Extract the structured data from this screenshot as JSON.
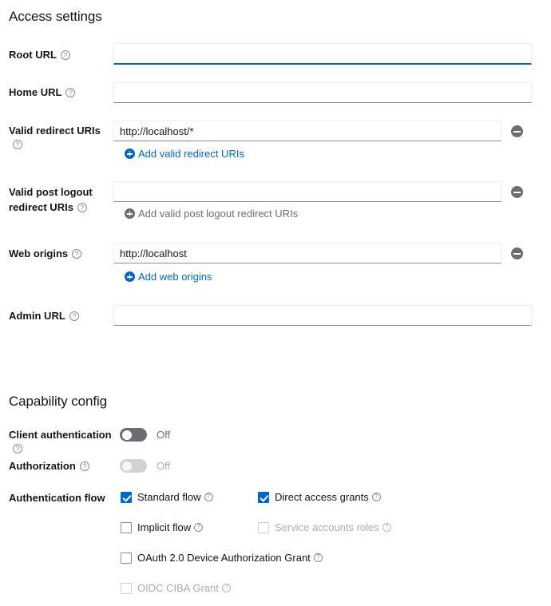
{
  "access_settings": {
    "title": "Access settings",
    "fields": [
      {
        "label": "Root URL",
        "value": "",
        "has_help": true,
        "focused": true,
        "has_remove": false,
        "add_link": null
      },
      {
        "label": "Home URL",
        "value": "",
        "has_help": true,
        "focused": false,
        "has_remove": false,
        "add_link": null
      },
      {
        "label": "Valid redirect URIs",
        "value": "http://localhost/*",
        "has_help": true,
        "focused": false,
        "has_remove": true,
        "add_link": "Add valid redirect URIs",
        "add_link_disabled": false
      },
      {
        "label_line1": "Valid post logout",
        "label_line2": "redirect URIs",
        "label": "Valid post logout redirect URIs",
        "value": "",
        "has_help": true,
        "focused": false,
        "has_remove": true,
        "add_link": "Add valid post logout redirect URIs",
        "add_link_disabled": true
      },
      {
        "label": "Web origins",
        "value": "http://localhost",
        "has_help": true,
        "focused": false,
        "has_remove": true,
        "add_link": "Add web origins",
        "add_link_disabled": false
      },
      {
        "label": "Admin URL",
        "value": "",
        "has_help": true,
        "focused": false,
        "has_remove": false,
        "add_link": null
      }
    ]
  },
  "capability_config": {
    "title": "Capability config",
    "client_authentication": {
      "label": "Client authentication",
      "state_text": "Off",
      "on": false,
      "disabled": false
    },
    "authorization": {
      "label": "Authorization",
      "state_text": "Off",
      "on": false,
      "disabled": true
    },
    "authentication_flow": {
      "label": "Authentication flow",
      "options": [
        {
          "label": "Standard flow",
          "checked": true,
          "disabled": false
        },
        {
          "label": "Direct access grants",
          "checked": true,
          "disabled": false
        },
        {
          "label": "Implicit flow",
          "checked": false,
          "disabled": false
        },
        {
          "label": "Service accounts roles",
          "checked": false,
          "disabled": true
        },
        {
          "label": "OAuth 2.0 Device Authorization Grant",
          "checked": false,
          "disabled": false
        },
        {
          "label": "OIDC CIBA Grant",
          "checked": false,
          "disabled": true
        }
      ]
    }
  },
  "colors": {
    "accent": "#0066cc",
    "text": "#151515",
    "muted": "#6a6e73",
    "disabled": "#aaadb1",
    "border": "#8a8d90"
  },
  "icons": {
    "help": "help-circle-icon",
    "add": "plus-circle-icon",
    "remove": "minus-circle-icon"
  }
}
